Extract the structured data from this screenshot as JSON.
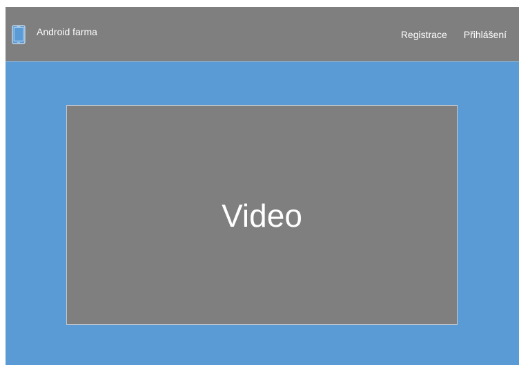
{
  "navbar": {
    "brand_icon": "tablet-icon",
    "brand_name": "Android farma",
    "links": {
      "register": "Registrace",
      "login": "Přihlášení"
    }
  },
  "main": {
    "video_label": "Video"
  },
  "colors": {
    "page_background": "#5b9bd5",
    "navbar_background": "#7f7f7f",
    "video_background": "#7f7f7f",
    "text": "#ffffff",
    "icon": "#5b9bd5"
  }
}
